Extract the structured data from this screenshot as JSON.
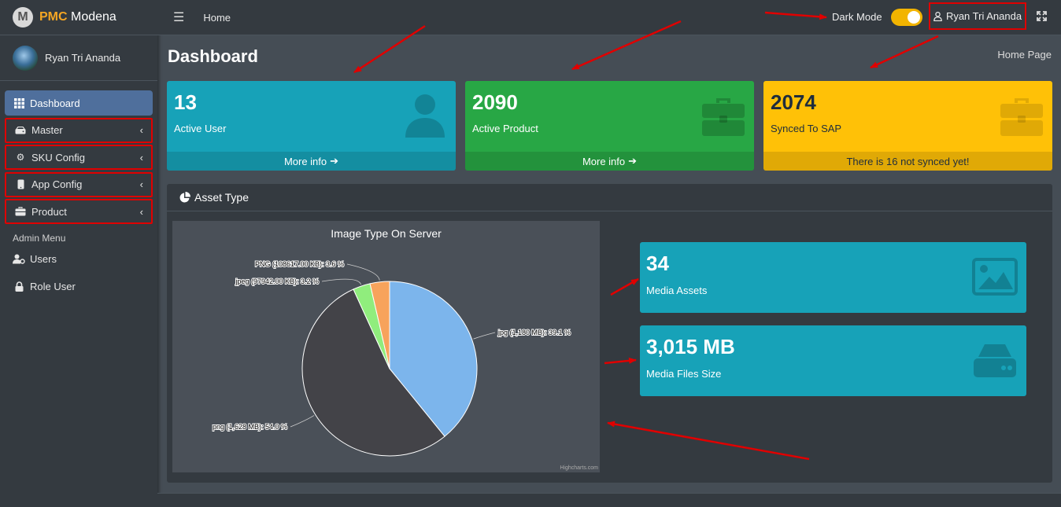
{
  "brand": {
    "logo_letter": "M",
    "name_bold": "PMC",
    "name_rest": " Modena"
  },
  "user": {
    "name": "Ryan Tri Ananda"
  },
  "sidebar": {
    "items": [
      {
        "label": "Dashboard"
      },
      {
        "label": "Master"
      },
      {
        "label": "SKU Config"
      },
      {
        "label": "App Config"
      },
      {
        "label": "Product"
      }
    ],
    "admin_header": "Admin Menu",
    "admin_items": [
      {
        "label": "Users"
      },
      {
        "label": "Role User"
      }
    ]
  },
  "topbar": {
    "home": "Home",
    "dark_mode_label": "Dark Mode",
    "user_name": "Ryan Tri Ananda"
  },
  "page": {
    "title": "Dashboard",
    "breadcrumb": "Home Page"
  },
  "cards": [
    {
      "value": "13",
      "label": "Active User",
      "footer": "More info",
      "color": "#17a2b8"
    },
    {
      "value": "2090",
      "label": "Active Product",
      "footer": "More info",
      "color": "#28a745"
    },
    {
      "value": "2074",
      "label": "Synced To SAP",
      "footer": "There is 16 not synced yet!",
      "color": "#ffc107"
    }
  ],
  "asset_panel": {
    "title": "Asset Type",
    "media_assets": {
      "value": "34",
      "label": "Media Assets"
    },
    "media_size": {
      "value": "3,015 MB",
      "label": "Media Files Size"
    }
  },
  "chart_data": {
    "type": "pie",
    "title": "Image Type On Server",
    "credit": "Highcharts.com",
    "slices": [
      {
        "name": "jpg",
        "label": "jpg (1,180 MB): 39.1 %",
        "value": 39.1,
        "color": "#7cb5ec"
      },
      {
        "name": "png",
        "label": "png (1,628 MB): 54.0 %",
        "value": 54.0,
        "color": "#434348"
      },
      {
        "name": "jpeg",
        "label": "jpeg (97942.00 KB): 3.2 %",
        "value": 3.2,
        "color": "#90ed7d"
      },
      {
        "name": "PNG",
        "label": "PNG (108617.00 KB): 3.6 %",
        "value": 3.6,
        "color": "#f7a35c"
      }
    ]
  }
}
